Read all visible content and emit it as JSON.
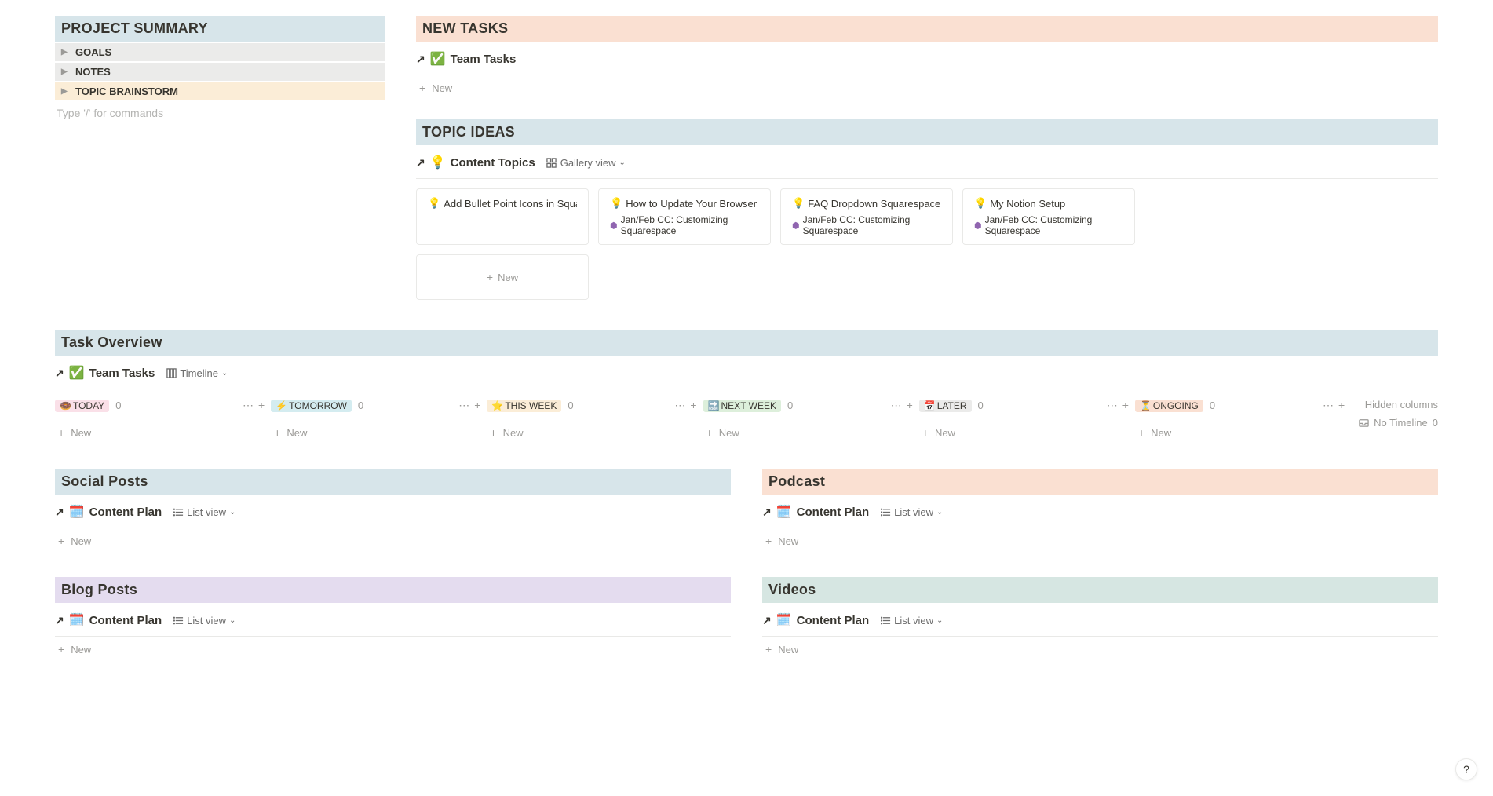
{
  "projectSummary": {
    "title": "PROJECT SUMMARY",
    "items": [
      {
        "label": "GOALS",
        "bg": "gray"
      },
      {
        "label": "NOTES",
        "bg": "gray"
      },
      {
        "label": "TOPIC BRAINSTORM",
        "bg": "yellow"
      }
    ],
    "placeholder": "Type '/' for commands"
  },
  "newTasks": {
    "title": "NEW TASKS",
    "dbIcon": "✅",
    "dbTitle": "Team Tasks",
    "newLabel": "New"
  },
  "topicIdeas": {
    "title": "TOPIC IDEAS",
    "dbIcon": "💡",
    "dbTitle": "Content Topics",
    "viewName": "Gallery view",
    "cards": [
      {
        "icon": "💡",
        "title": "Add Bullet Point Icons in Squares…",
        "tag": ""
      },
      {
        "icon": "💡",
        "title": "How to Update Your Browser Icon…",
        "tag": "Jan/Feb CC: Customizing Squarespace"
      },
      {
        "icon": "💡",
        "title": "FAQ Dropdown Squarespace",
        "tag": "Jan/Feb CC: Customizing Squarespace"
      },
      {
        "icon": "💡",
        "title": "My Notion Setup",
        "tag": "Jan/Feb CC: Customizing Squarespace"
      }
    ],
    "newLabel": "New"
  },
  "taskOverview": {
    "title": "Task Overview",
    "dbIcon": "✅",
    "dbTitle": "Team Tasks",
    "viewName": "Timeline",
    "columns": [
      {
        "icon": "🍩",
        "label": "TODAY",
        "count": "0",
        "badge": "badge-pink"
      },
      {
        "icon": "⚡",
        "label": "TOMORROW",
        "count": "0",
        "badge": "badge-cyan"
      },
      {
        "icon": "⭐",
        "label": "THIS WEEK",
        "count": "0",
        "badge": "badge-yellow"
      },
      {
        "icon": "🔜",
        "label": "NEXT WEEK",
        "count": "0",
        "badge": "badge-green"
      },
      {
        "icon": "📅",
        "label": "LATER",
        "count": "0",
        "badge": "badge-gray"
      },
      {
        "icon": "⏳",
        "label": "ONGOING",
        "count": "0",
        "badge": "badge-orange"
      }
    ],
    "hiddenLabel": "Hidden columns",
    "noTimelineLabel": "No Timeline",
    "noTimelineCount": "0",
    "newLabel": "New"
  },
  "socialPosts": {
    "title": "Social Posts",
    "dbIcon": "🗓️",
    "dbTitle": "Content Plan",
    "viewName": "List view",
    "newLabel": "New"
  },
  "podcast": {
    "title": "Podcast",
    "dbIcon": "🗓️",
    "dbTitle": "Content Plan",
    "viewName": "List view",
    "newLabel": "New"
  },
  "blogPosts": {
    "title": "Blog Posts",
    "dbIcon": "🗓️",
    "dbTitle": "Content Plan",
    "viewName": "List view",
    "newLabel": "New"
  },
  "videos": {
    "title": "Videos",
    "dbIcon": "🗓️",
    "dbTitle": "Content Plan",
    "viewName": "List view",
    "newLabel": "New"
  },
  "helpLabel": "?"
}
